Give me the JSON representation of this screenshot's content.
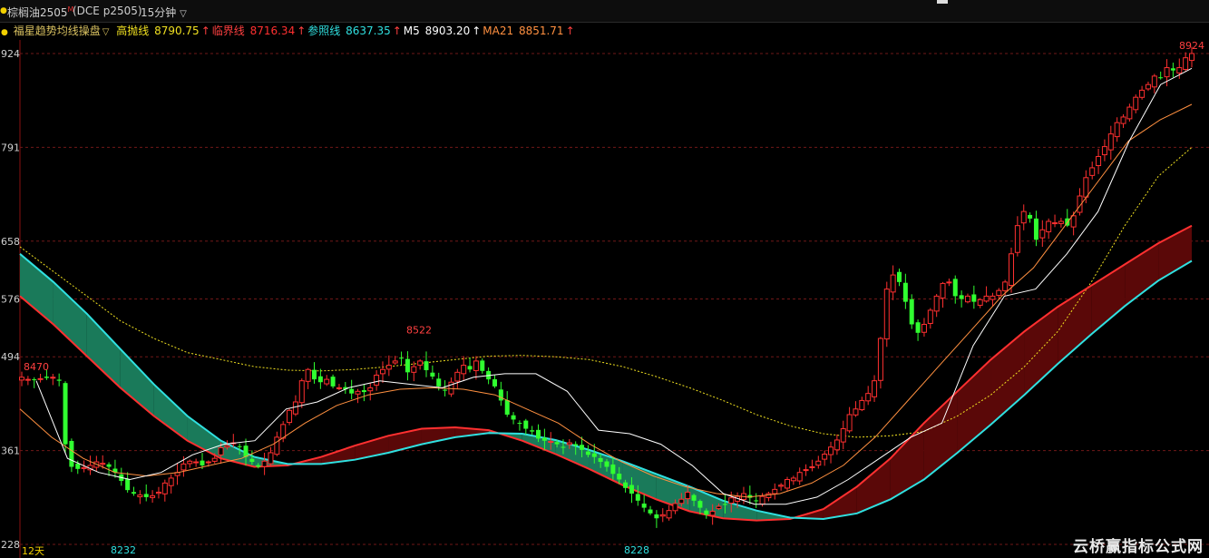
{
  "header": {
    "symbol": "棕榈油2505",
    "symbol_mark": "M",
    "code": "(DCE p2505)",
    "period": "15分钟",
    "win_icon": "window-icon"
  },
  "indicator": {
    "name": "福星趋势均线操盘",
    "items": [
      {
        "label": "高抛线",
        "value": "8790.75",
        "color": "#f0e020"
      },
      {
        "label": "临界线",
        "value": "8716.34",
        "color": "#ff3030"
      },
      {
        "label": "参照线",
        "value": "8637.35",
        "color": "#30e0e0"
      },
      {
        "label": "M5",
        "value": "8903.20",
        "color": "#ffffff"
      },
      {
        "label": "MA21",
        "value": "8851.71",
        "color": "#ff9040"
      }
    ]
  },
  "chart_data": {
    "type": "candlestick",
    "y_ticks": [
      {
        "value": 8924,
        "label": "924"
      },
      {
        "value": 8791,
        "label": "791"
      },
      {
        "value": 8658,
        "label": "658"
      },
      {
        "value": 8576,
        "label": "576"
      },
      {
        "value": 8494,
        "label": "494"
      },
      {
        "value": 8361,
        "label": "361"
      },
      {
        "value": 8228,
        "label": "228"
      }
    ],
    "ylim": [
      8228,
      8924
    ],
    "annotations": [
      {
        "text": "8924",
        "value": 8924,
        "color": "#ff4040"
      },
      {
        "text": "8470",
        "value": 8470,
        "color": "#ff4040"
      },
      {
        "text": "8522",
        "value": 8522,
        "color": "#ff4040"
      },
      {
        "text": "8232",
        "value": 8232,
        "color": "#30e0e0"
      },
      {
        "text": "8228",
        "value": 8228,
        "color": "#30e0e0"
      }
    ],
    "x_label": "12天",
    "close": [
      8465,
      8462,
      8462,
      8463,
      8464,
      8465,
      8460,
      8370,
      8338,
      8335,
      8337,
      8340,
      8345,
      8343,
      8338,
      8330,
      8318,
      8305,
      8300,
      8298,
      8295,
      8297,
      8302,
      8315,
      8322,
      8330,
      8342,
      8346,
      8345,
      8340,
      8345,
      8350,
      8365,
      8368,
      8372,
      8366,
      8352,
      8345,
      8338,
      8346,
      8358,
      8380,
      8398,
      8418,
      8430,
      8460,
      8476,
      8462,
      8458,
      8462,
      8452,
      8450,
      8448,
      8442,
      8445,
      8444,
      8450,
      8468,
      8476,
      8482,
      8488,
      8492,
      8472,
      8480,
      8488,
      8475,
      8466,
      8452,
      8446,
      8458,
      8472,
      8482,
      8476,
      8488,
      8474,
      8462,
      8452,
      8432,
      8412,
      8405,
      8400,
      8392,
      8388,
      8378,
      8375,
      8374,
      8370,
      8365,
      8372,
      8368,
      8362,
      8355,
      8352,
      8345,
      8338,
      8328,
      8320,
      8308,
      8300,
      8290,
      8280,
      8272,
      8265,
      8270,
      8276,
      8286,
      8292,
      8302,
      8290,
      8280,
      8270,
      8275,
      8282,
      8284,
      8294,
      8296,
      8300,
      8294,
      8290,
      8296,
      8300,
      8306,
      8312,
      8320,
      8322,
      8330,
      8334,
      8338,
      8346,
      8356,
      8366,
      8376,
      8392,
      8412,
      8420,
      8432,
      8442,
      8460,
      8520,
      8590,
      8610,
      8600,
      8572,
      8540,
      8528,
      8540,
      8560,
      8580,
      8598,
      8600,
      8580,
      8576,
      8580,
      8572,
      8575,
      8580,
      8580,
      8588,
      8600,
      8640,
      8680,
      8700,
      8690,
      8660,
      8674,
      8686,
      8684,
      8686,
      8680,
      8694,
      8722,
      8748,
      8762,
      8778,
      8792,
      8810,
      8826,
      8834,
      8848,
      8862,
      8872,
      8880,
      8892,
      8890,
      8904,
      8900,
      8904,
      8918,
      8924
    ],
    "series": [
      {
        "name": "高抛线",
        "color": "#f0e020",
        "values": [
          8650,
          8615,
          8580,
          8545,
          8520,
          8500,
          8490,
          8480,
          8475,
          8474,
          8476,
          8480,
          8485,
          8490,
          8495,
          8496,
          8494,
          8490,
          8480,
          8466,
          8450,
          8432,
          8412,
          8396,
          8385,
          8380,
          8382,
          8388,
          8410,
          8440,
          8480,
          8530,
          8600,
          8680,
          8750,
          8791
        ]
      },
      {
        "name": "临界线",
        "color": "#ff3030",
        "values": [
          8580,
          8540,
          8495,
          8450,
          8410,
          8375,
          8350,
          8338,
          8340,
          8352,
          8368,
          8382,
          8392,
          8394,
          8390,
          8375,
          8356,
          8335,
          8312,
          8292,
          8275,
          8265,
          8262,
          8264,
          8278,
          8310,
          8350,
          8400,
          8445,
          8490,
          8530,
          8565,
          8595,
          8625,
          8655,
          8680
        ]
      },
      {
        "name": "参照线",
        "color": "#30e0e0",
        "values": [
          8640,
          8600,
          8555,
          8505,
          8455,
          8410,
          8375,
          8352,
          8342,
          8342,
          8348,
          8358,
          8370,
          8380,
          8386,
          8385,
          8376,
          8362,
          8346,
          8328,
          8310,
          8290,
          8276,
          8266,
          8264,
          8272,
          8292,
          8320,
          8358,
          8398,
          8440,
          8484,
          8526,
          8566,
          8602,
          8630
        ]
      },
      {
        "name": "M5",
        "color": "#ffffff",
        "values": [
          8460,
          8350,
          8330,
          8320,
          8330,
          8355,
          8370,
          8375,
          8420,
          8430,
          8450,
          8460,
          8455,
          8450,
          8465,
          8470,
          8470,
          8445,
          8390,
          8385,
          8370,
          8340,
          8300,
          8285,
          8285,
          8295,
          8320,
          8350,
          8380,
          8400,
          8510,
          8580,
          8590,
          8640,
          8700,
          8800,
          8880,
          8903
        ]
      },
      {
        "name": "MA21",
        "color": "#ff9040",
        "values": [
          8420,
          8380,
          8350,
          8330,
          8325,
          8330,
          8340,
          8350,
          8370,
          8400,
          8425,
          8440,
          8448,
          8450,
          8448,
          8440,
          8420,
          8400,
          8370,
          8345,
          8325,
          8310,
          8300,
          8295,
          8300,
          8315,
          8340,
          8380,
          8430,
          8480,
          8530,
          8580,
          8620,
          8680,
          8740,
          8800,
          8830,
          8852
        ]
      }
    ]
  },
  "watermark": "云桥赢指标公式网"
}
